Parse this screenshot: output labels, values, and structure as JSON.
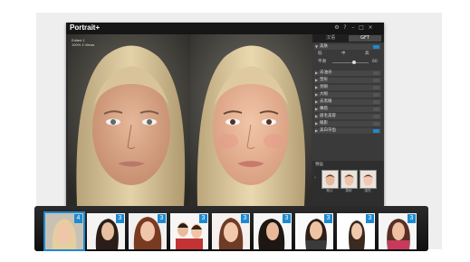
{
  "app": {
    "title": "Portrait+"
  },
  "window_controls": {
    "help": "?",
    "minimize": "–",
    "maximize": "□",
    "close": "×"
  },
  "photo_meta": {
    "line1": "Edited 1",
    "line2": "100% 4 Views"
  },
  "panel": {
    "tabs": [
      {
        "label": "汉语"
      },
      {
        "label": "GFT"
      }
    ],
    "sections": [
      {
        "label": "美肤",
        "on": true
      },
      {
        "label": "去油光",
        "on": false
      },
      {
        "label": "塑形",
        "on": false
      },
      {
        "label": "亮眼",
        "on": false
      },
      {
        "label": "大眼",
        "on": false
      },
      {
        "label": "去黑眼",
        "on": false
      },
      {
        "label": "嘴唇",
        "on": false
      },
      {
        "label": "眉毛美容",
        "on": false
      },
      {
        "label": "眼影",
        "on": false
      },
      {
        "label": "美白牙齿",
        "on": true
      }
    ],
    "slider_label": "平滑",
    "slider_value": "60",
    "sub_labels": [
      "低",
      "中",
      "高"
    ],
    "presets_title": "预设",
    "preset_labels": [
      "默认",
      "柔和",
      "强烈"
    ]
  },
  "filmstrip": [
    {
      "badge": "4"
    },
    {
      "badge": "3"
    },
    {
      "badge": "3"
    },
    {
      "badge": "3"
    },
    {
      "badge": "3"
    },
    {
      "badge": "3"
    },
    {
      "badge": "3"
    },
    {
      "badge": "3"
    },
    {
      "badge": "3"
    }
  ],
  "colors": {
    "accent": "#1d8ad0",
    "window": "#2b2b2b",
    "panel": "#3a3a3a"
  }
}
